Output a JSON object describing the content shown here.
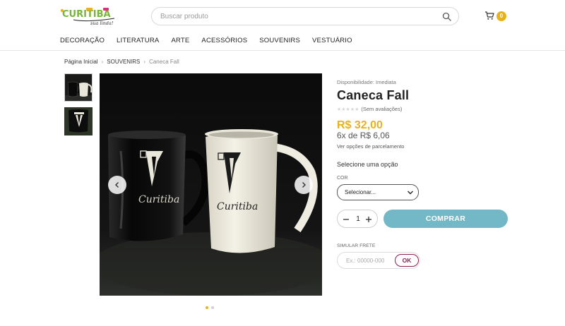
{
  "header": {
    "logo_text": "CURITIBA",
    "logo_tagline": "sua linda!",
    "search": {
      "placeholder": "Buscar produto",
      "value": ""
    },
    "cart": {
      "count": "0"
    }
  },
  "nav": {
    "items": [
      {
        "label": "DECORAÇÃO"
      },
      {
        "label": "LITERATURA"
      },
      {
        "label": "ARTE"
      },
      {
        "label": "ACESSÓRIOS"
      },
      {
        "label": "SOUVENIRS"
      },
      {
        "label": "VESTUÁRIO"
      }
    ]
  },
  "breadcrumb": {
    "items": [
      {
        "label": "Página Inicial"
      },
      {
        "label": "SOUVENIRS"
      },
      {
        "label": "Caneca Fall"
      }
    ],
    "separator": "›"
  },
  "gallery": {
    "image_text": "Curitiba",
    "slide_count": 2,
    "active_slide": 1
  },
  "product": {
    "availability": "Disponibilidade: Imediata",
    "title": "Caneca Fall",
    "stars": "★★★★★",
    "rating": 0,
    "reviews": "(Sem avaliações)",
    "price": "R$ 32,00",
    "installments": "6x de R$ 6,06",
    "installments_link": "Ver opções de parcelamento",
    "choose_option": "Selecione uma opção",
    "color_label": "COR",
    "color_select": "Selecionar...",
    "quantity": "1",
    "buy_label": "COMPRAR",
    "shipping_label": "SIMULAR FRETE",
    "shipping_placeholder": "Ex.: 00000-000",
    "shipping_button": "OK"
  },
  "colors": {
    "accent_yellow": "#e7b21c",
    "buy_button": "#72b8c6",
    "ok_button": "#8a1e4e"
  }
}
